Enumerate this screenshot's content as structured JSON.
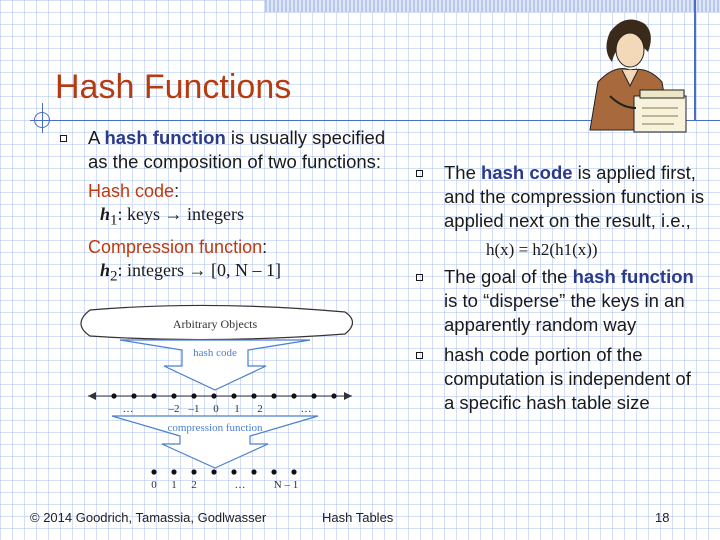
{
  "title": "Hash Functions",
  "left": {
    "bullet1": {
      "prefix": "A ",
      "kw": "hash function",
      "suffix": " is usually specified as the composition of two functions:"
    },
    "hash_code_label": "Hash code",
    "hash_code_formula": {
      "h": "h",
      "sub": "1",
      "rest": ": keys → integers"
    },
    "compression_label": "Compression function",
    "compression_formula": {
      "h": "h",
      "sub": "2",
      "rest": ": integers → [0, N – 1]"
    }
  },
  "right": {
    "bullet1": {
      "prefix": "The ",
      "kw": "hash code",
      "suffix": " is applied first, and the compression function is applied next on the result, i.e.,"
    },
    "formula": "h(x) = h2(h1(x))",
    "bullet2": {
      "prefix": "The goal of the ",
      "kw": "hash function",
      "suffix": " is to  “disperse” the keys in an apparently random way"
    },
    "bullet3": "hash code portion of the computation is independent of a specific hash table size"
  },
  "diagram": {
    "top_label": "Arbitrary Objects",
    "hash_code_label": "hash code",
    "int_ticks": [
      "…",
      "–2",
      "–1",
      "0",
      "1",
      "2",
      "…"
    ],
    "compression_label": "compression function",
    "range_ticks": [
      "0",
      "1",
      "2",
      "…",
      "N – 1"
    ]
  },
  "footer": {
    "copyright": "© 2014 Goodrich, Tamassia, Godlwasser",
    "topic": "Hash Tables",
    "page": "18"
  },
  "colors": {
    "title": "#b83b0f",
    "accent": "#c0390e",
    "keyword": "#2b3a8a",
    "grid": "#a0b9e6"
  }
}
